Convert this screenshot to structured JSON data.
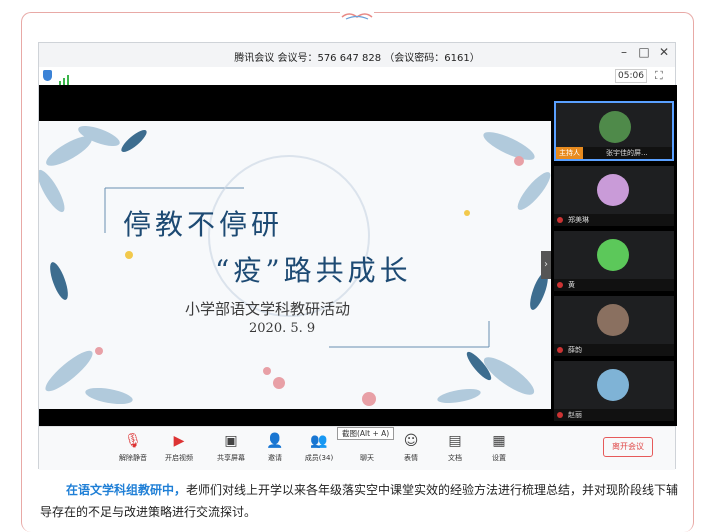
{
  "window": {
    "title": "腾讯会议 会议号：576 647 828 （会议密码：6161）",
    "time": "05:06"
  },
  "slide": {
    "title_line1": "停教不停研",
    "title_line2": "“疫”路共成长",
    "subtitle": "小学部语文学科教研活动",
    "date": "2020. 5. 9"
  },
  "participants": [
    {
      "name": "张宇佳的屏...",
      "role": "主持人",
      "color": "#4f8a4a"
    },
    {
      "name": "郑美琳",
      "color": "#c99bd8"
    },
    {
      "name": "黄",
      "color": "#5cc85a"
    },
    {
      "name": "薛韵",
      "color": "#8a7060"
    },
    {
      "name": "赵丽",
      "color": "#7fb3d6"
    }
  ],
  "toolbar": {
    "mute": "解除静音",
    "video": "开启视频",
    "share": "共享屏幕",
    "invite": "邀请",
    "members": "成员(34)",
    "chat": "聊天",
    "emoji": "表情",
    "docs": "文档",
    "settings": "设置",
    "shortcut": "截图(Alt + A)",
    "leave": "离开会议"
  },
  "caption": {
    "highlight": "在语文学科组教研中，",
    "text": "老师们对线上开学以来各年级落实空中课堂实效的经验方法进行梳理总结，并对现阶段线下辅导存在的不足与改进策略进行交流探讨。"
  }
}
